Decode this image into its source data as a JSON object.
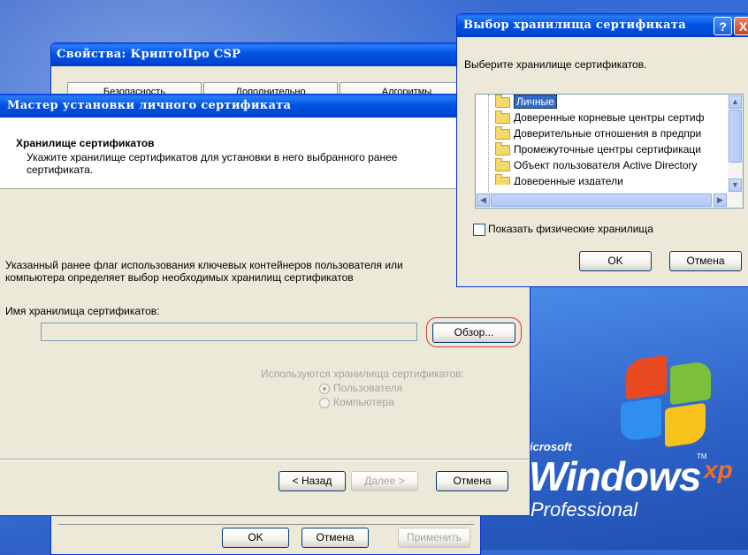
{
  "props_window": {
    "title": "Свойства: КриптоПро CSP",
    "tabs": [
      "Безопасность",
      "Дополнительно",
      "Алгоритмы"
    ],
    "ok_label": "OK",
    "cancel_label": "Отмена",
    "apply_label": "Применить"
  },
  "wizard": {
    "title": "Мастер установки личного сертификата",
    "header_title": "Хранилище сертификатов",
    "header_desc": "Укажите хранилище сертификатов для установки в него выбранного ранее сертификата.",
    "info_text": "Указанный ранее флаг использования ключевых контейнеров пользователя или компьютера определяет выбор необходимых хранилищ сертификатов",
    "store_name_label": "Имя хранилища сертификатов:",
    "store_name_value": "",
    "browse_label": "Обзор...",
    "used_stores_label": "Используются хранилища сертификатов:",
    "radio_user": "Пользователя",
    "radio_computer": "Компьютера",
    "back_label": "< Назад",
    "next_label": "Далее >",
    "cancel_label": "Отмена"
  },
  "store_dialog": {
    "title": "Выбор хранилища сертификата",
    "prompt": "Выберите хранилище сертификатов.",
    "stores": [
      "Личные",
      "Доверенные корневые центры сертиф",
      "Доверительные отношения в предпри",
      "Промежуточные центры сертификаци",
      "Объект пользователя Active Directory",
      "Доверенные издатели"
    ],
    "selected_index": 0,
    "show_physical_label": "Показать физические хранилища",
    "show_physical_checked": false,
    "ok_label": "OK",
    "cancel_label": "Отмена",
    "help_glyph": "?",
    "close_glyph": "X"
  },
  "desktop": {
    "brand_microsoft": "icrosoft",
    "brand_windows": "Windows",
    "brand_xp": "xp",
    "brand_edition": "Professional",
    "brand_tm": "TM"
  },
  "colors": {
    "title_blue": "#0054e3",
    "highlight_red": "#d23a3a",
    "selection": "#316ac5"
  }
}
